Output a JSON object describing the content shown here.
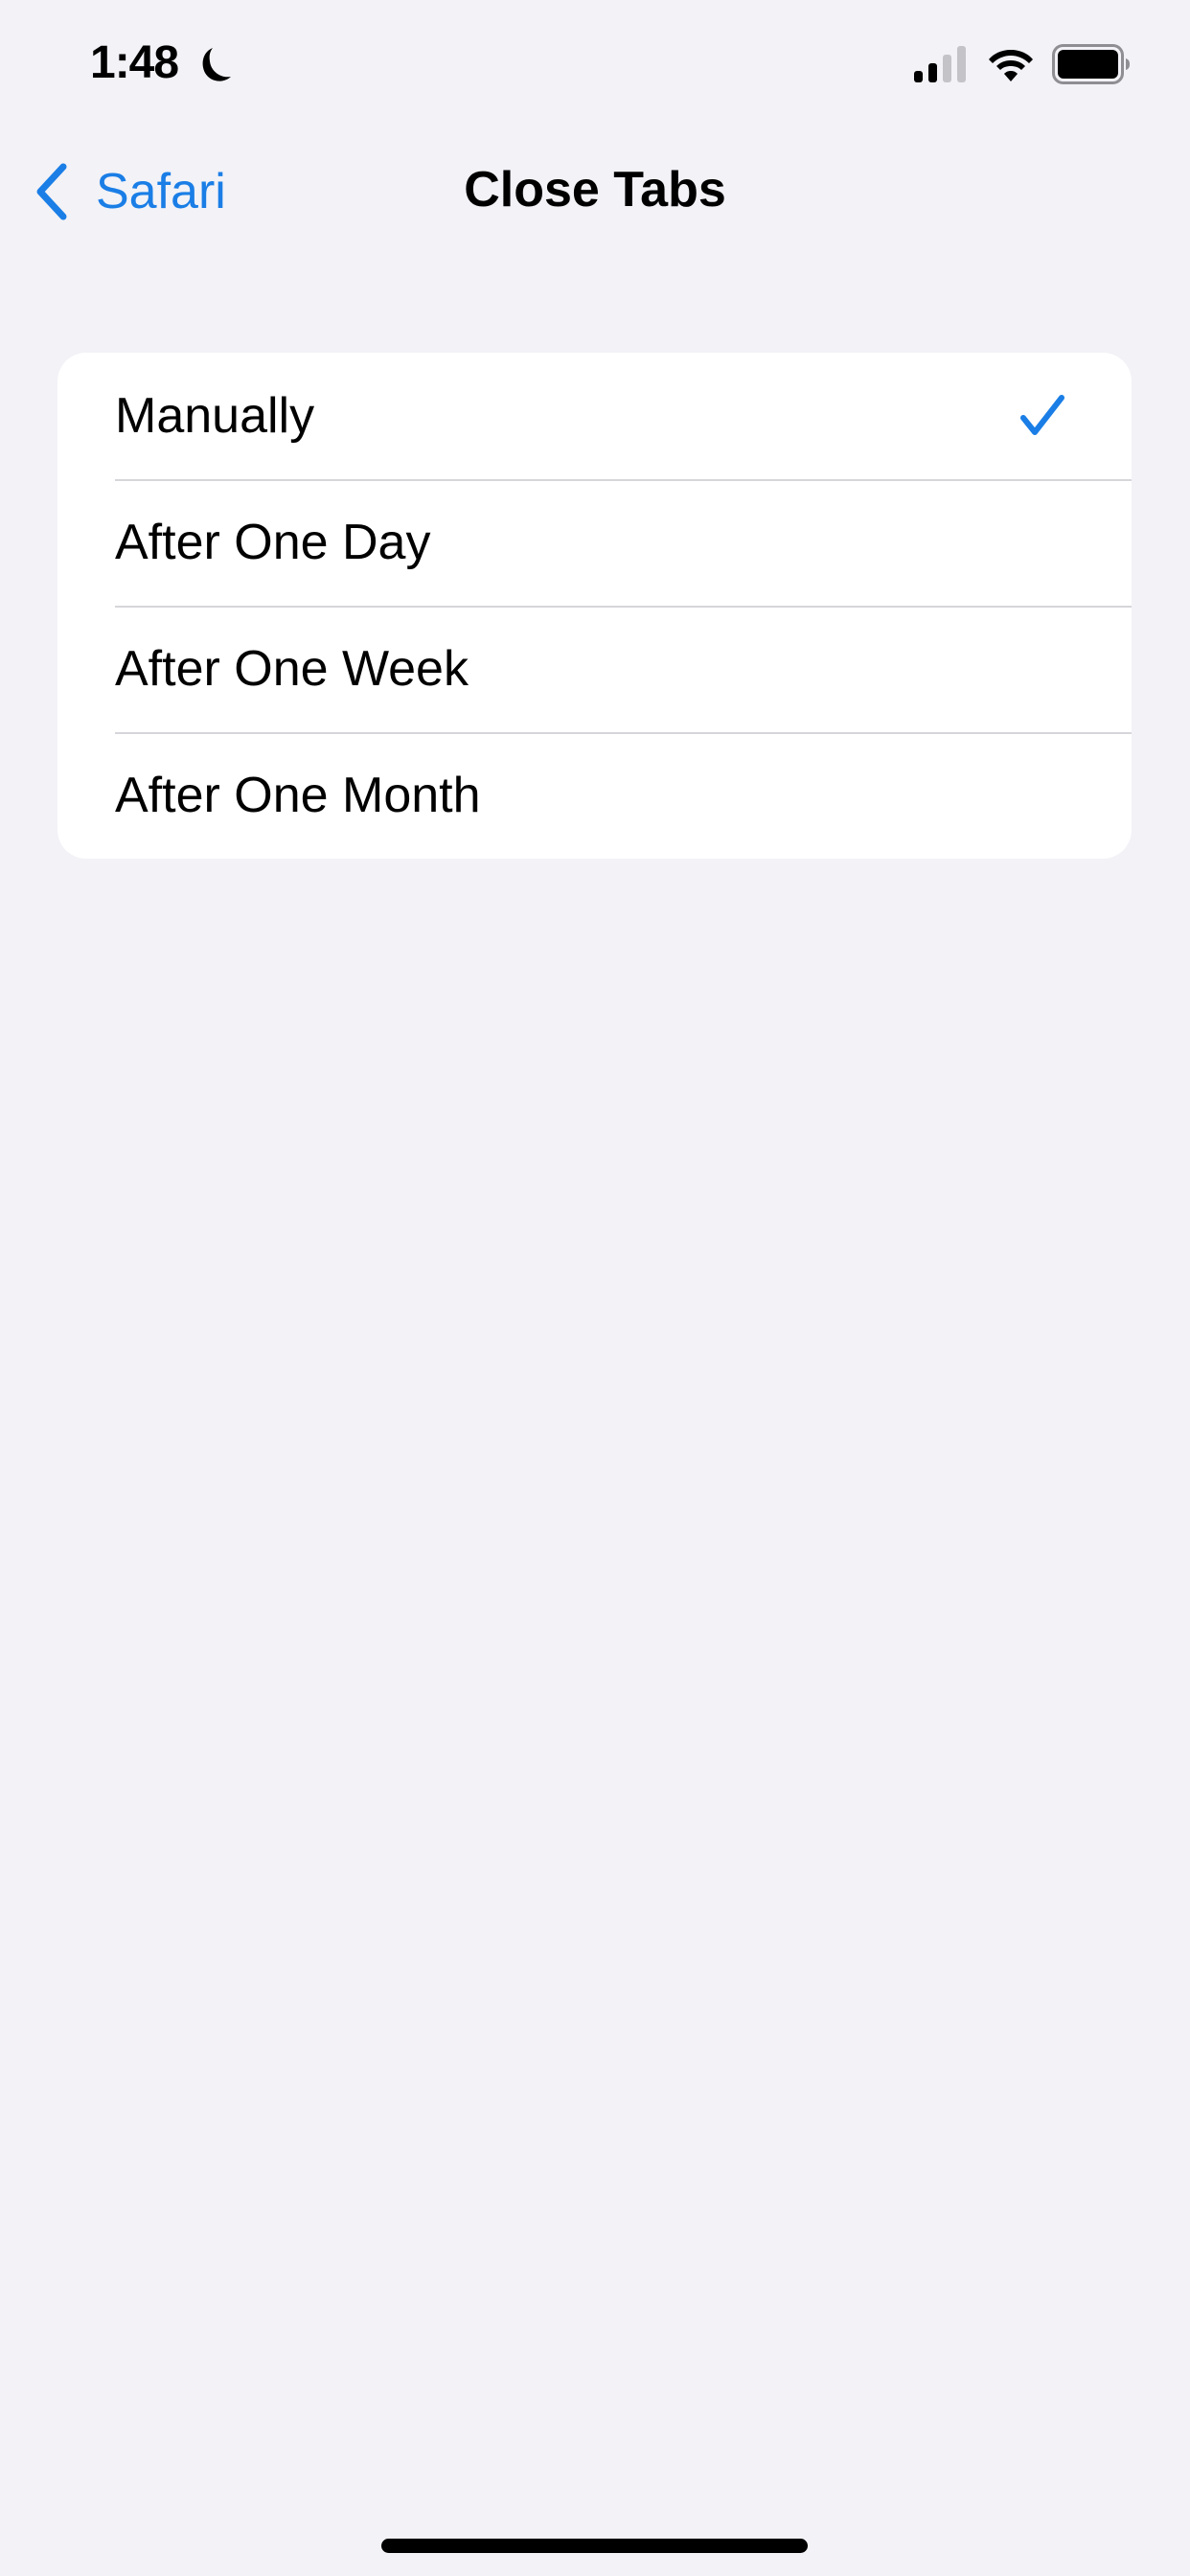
{
  "status_bar": {
    "time": "1:48",
    "focus_mode_icon": "moon-icon",
    "signal_icon": "cellular-signal-icon",
    "signal_bars_active": 2,
    "signal_bars_total": 4,
    "wifi_icon": "wifi-icon",
    "battery_icon": "battery-icon",
    "battery_level": 1.0
  },
  "nav": {
    "back_icon": "chevron-left-icon",
    "back_label": "Safari",
    "title": "Close Tabs"
  },
  "options": {
    "items": [
      {
        "label": "Manually",
        "selected": true
      },
      {
        "label": "After One Day",
        "selected": false
      },
      {
        "label": "After One Week",
        "selected": false
      },
      {
        "label": "After One Month",
        "selected": false
      }
    ],
    "selected_icon": "checkmark-icon"
  },
  "colors": {
    "accent": "#1a7ee6",
    "background": "#f2f2f7",
    "card": "#ffffff",
    "separator": "#d6d6da"
  }
}
